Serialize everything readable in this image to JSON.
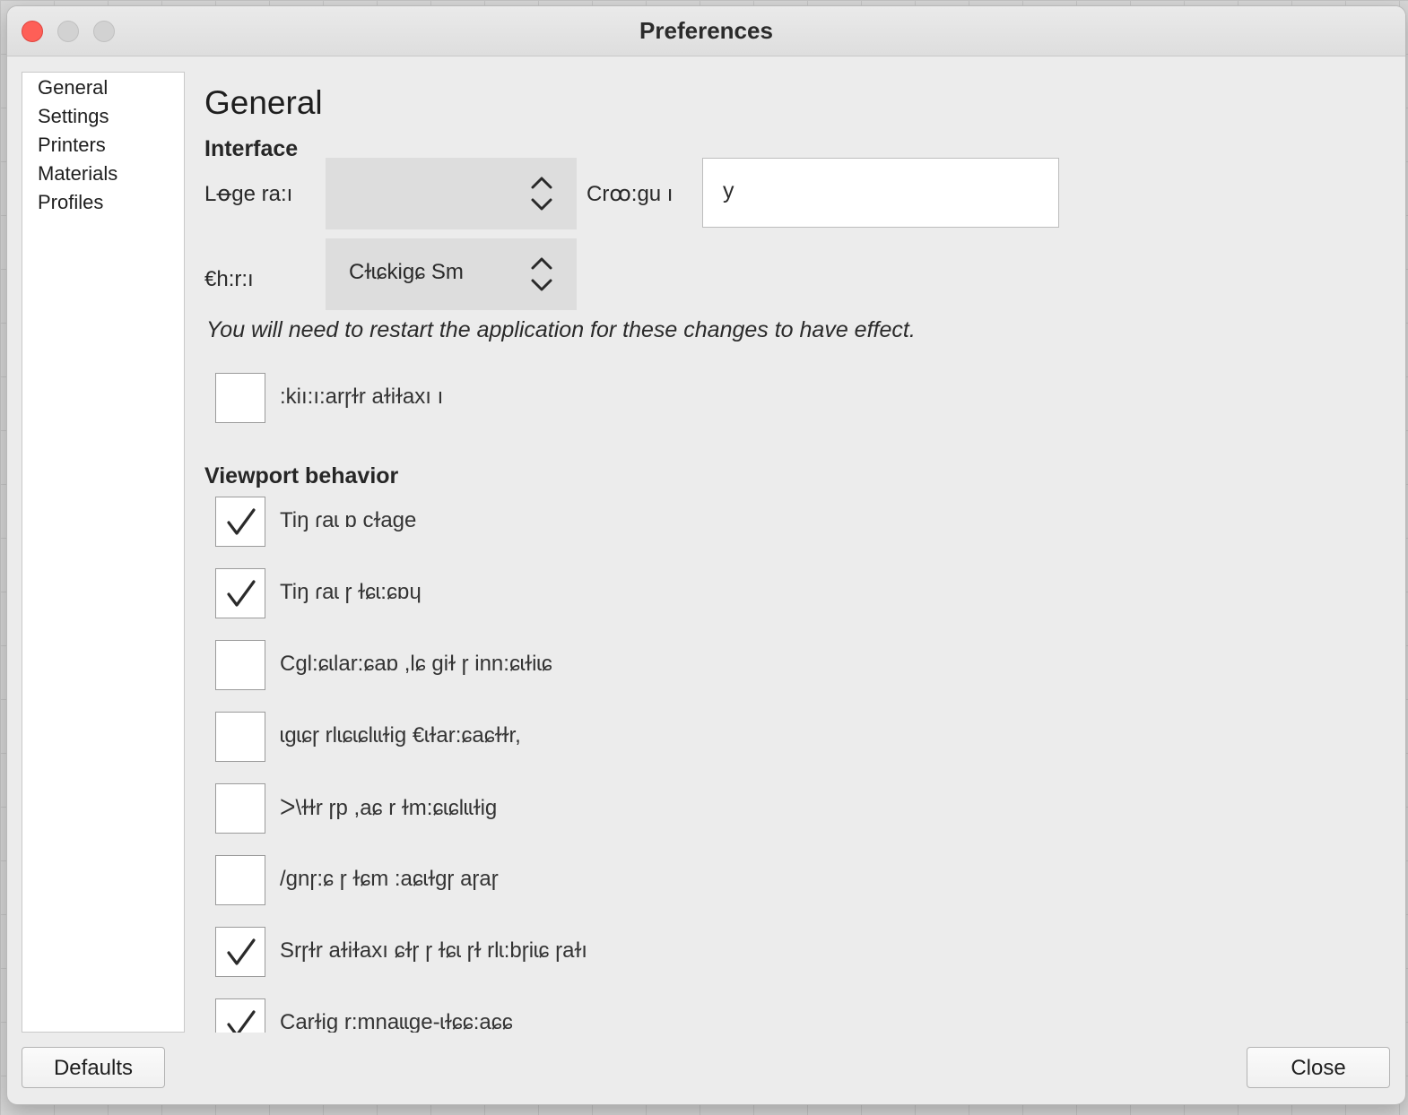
{
  "window": {
    "title": "Preferences"
  },
  "sidebar": {
    "items": [
      {
        "label": "General"
      },
      {
        "label": "Settings"
      },
      {
        "label": "Printers"
      },
      {
        "label": "Materials"
      },
      {
        "label": "Profiles"
      }
    ]
  },
  "general": {
    "page_title": "General",
    "interface": {
      "heading": "Interface",
      "language_label": "Lꝋge ra:ı",
      "language_value": "",
      "currency_label": "Crꝏ:gu ı",
      "currency_value": "y",
      "theme_label": "€h:r:ı",
      "theme_value": "Cɫɩɕkigɕ Sm",
      "restart_note": "You will need to restart the application for these changes to have effect.",
      "slice_checkbox": {
        "label": ":kiı:ı:arɼɫr aɫiɫaxı ı",
        "checked": false
      }
    },
    "viewport": {
      "heading": "Viewport behavior",
      "options": [
        {
          "label": "Tiŋ ɾaɩ ɒ cɫaɡe",
          "checked": true
        },
        {
          "label": "Tiŋ ɾaɩ ɼ ɫɕɩ:ɕɒɥ",
          "checked": true
        },
        {
          "label": "Cɡl:ɕɩlar:ɕaɒ ,lɕ giɫ ɼ inn:ɕɩɫiɩɕ",
          "checked": false
        },
        {
          "label": "ɩgɩɕɼ rlɩɕɩɕlɩɩɫiɡ €ɩɫar:ɕaɕɫɫr,",
          "checked": false
        },
        {
          "label": "ᐳ\\ɫɫr  ɼp ,aɕ r ɫm:ɕɩɕlɩɩɫiɡ",
          "checked": false
        },
        {
          "label": "/gnɼ:ɕ ɼ ɫɕm :aɕɩɫɡɼ aɼaɼ",
          "checked": false
        },
        {
          "label": "Srɼɫr aɫiɫaxı ɕɫɼ ɼ ɫɕɩ ɼɫ rlɩ:bɼiɩɕ ɼaɫı",
          "checked": true
        },
        {
          "label": "Carɫiɡ r:mnaɩɩɡe-ɩɫɕɕ:aɕɕ",
          "checked": true
        }
      ]
    }
  },
  "footer": {
    "defaults_label": "Defaults",
    "close_label": "Close"
  },
  "colors": {
    "window_bg": "#ececec",
    "close_button": "#fe5f57",
    "checkmark": "#2a2a2a"
  }
}
